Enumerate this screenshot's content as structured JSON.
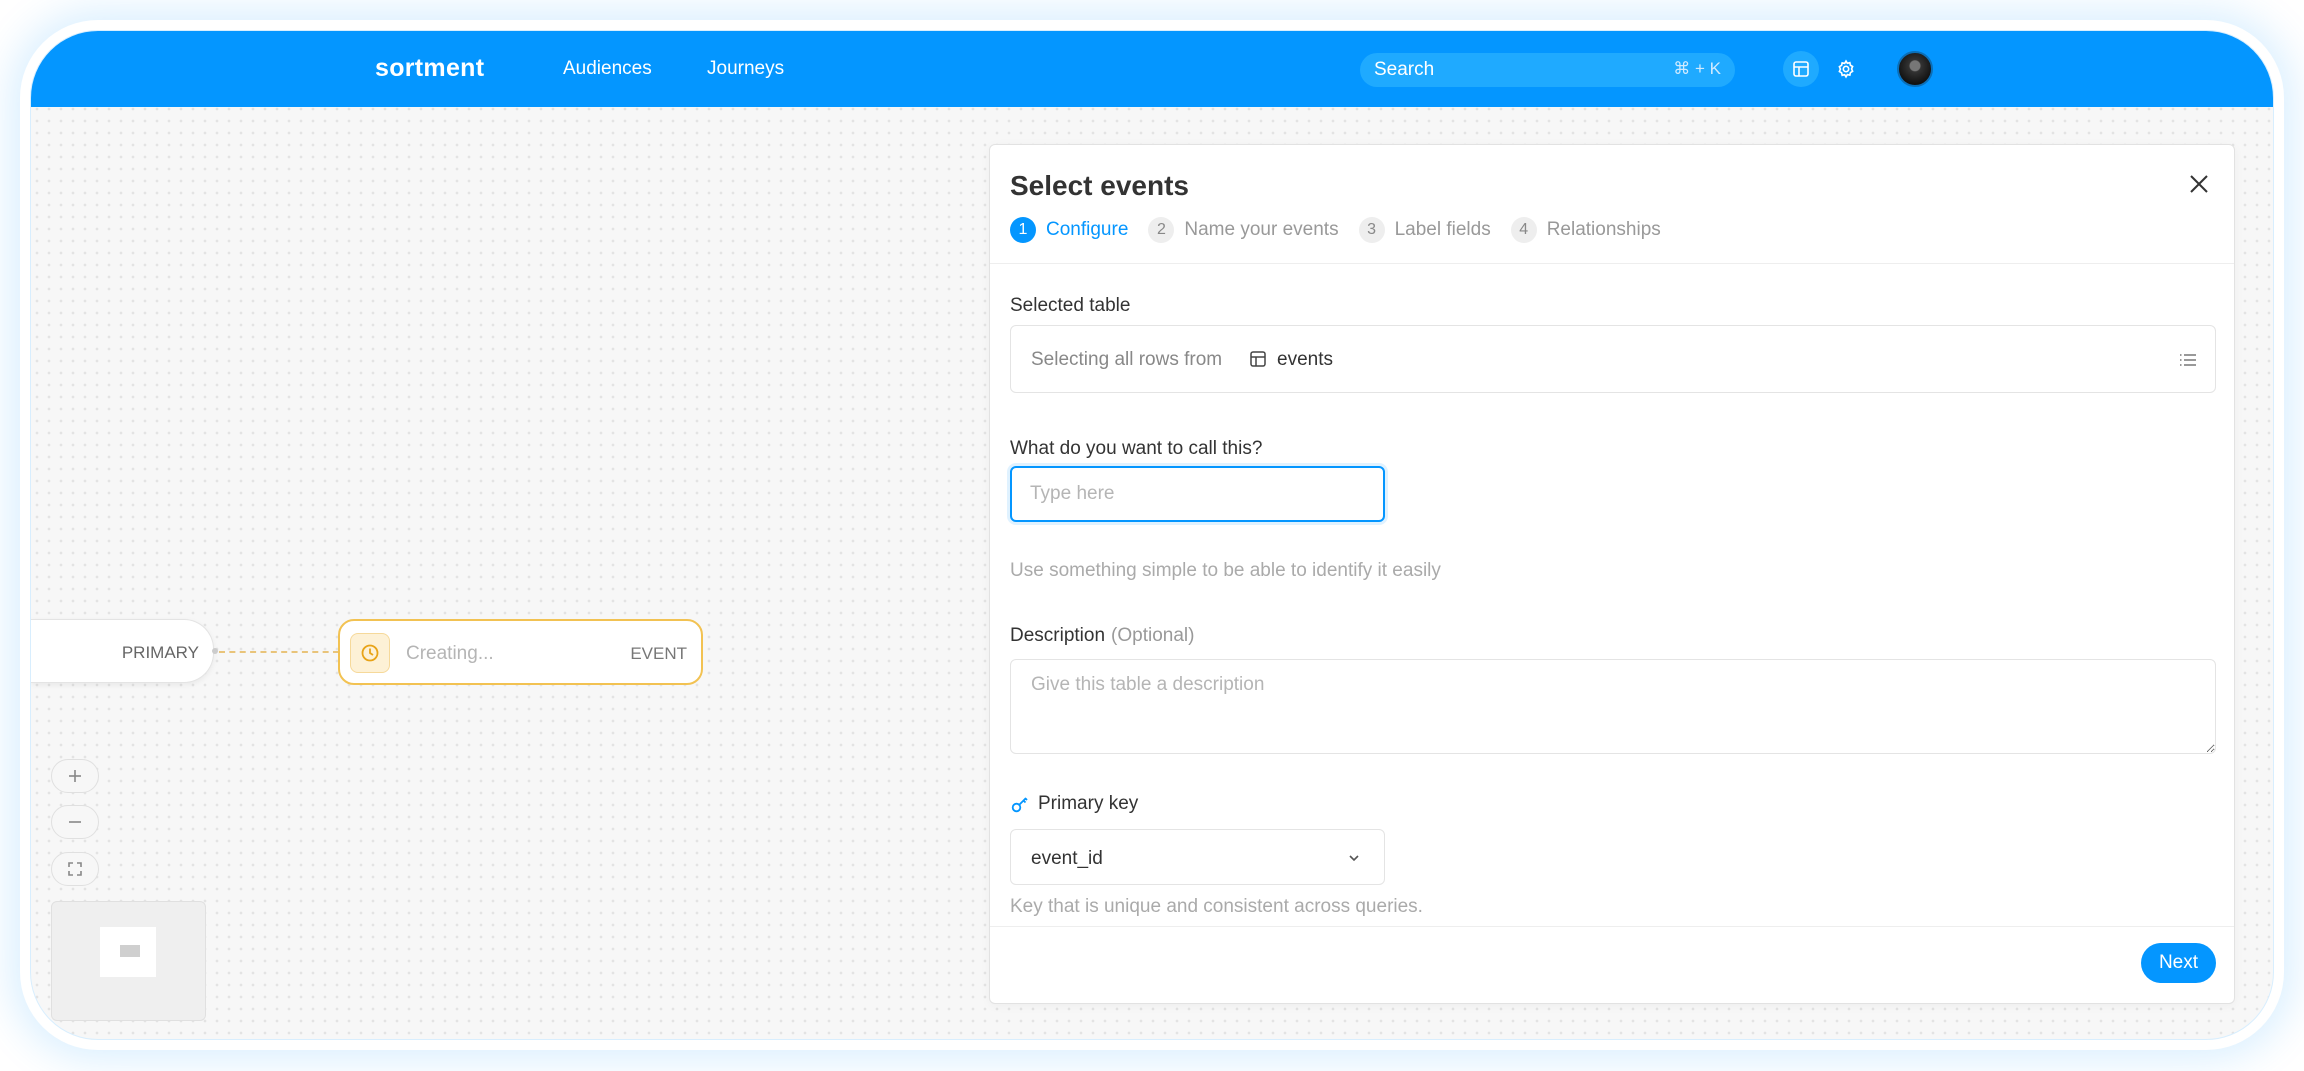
{
  "app": {
    "logo": "sortment",
    "nav": [
      "Audiences",
      "Journeys"
    ],
    "search_placeholder": "Search",
    "search_shortcut": "⌘ + K",
    "accent_color": "#0496ff"
  },
  "canvas": {
    "primary_node_label": "PRIMARY",
    "event_node_status": "Creating...",
    "event_node_type": "EVENT",
    "zoom_controls": [
      "plus-icon",
      "minus-icon",
      "fit-view-icon"
    ]
  },
  "dialog": {
    "title": "Select events",
    "steps": [
      {
        "num": "1",
        "label": "Configure",
        "active": true
      },
      {
        "num": "2",
        "label": "Name your events",
        "active": false
      },
      {
        "num": "3",
        "label": "Label fields",
        "active": false
      },
      {
        "num": "4",
        "label": "Relationships",
        "active": false
      }
    ],
    "selected_table": {
      "label": "Selected table",
      "prefix": "Selecting all rows from",
      "table_name": "events"
    },
    "name_field": {
      "label": "What do you want to call this?",
      "placeholder": "Type here",
      "value": "",
      "hint": "Use something simple to be able to identify it easily"
    },
    "description_field": {
      "label": "Description",
      "optional": "(Optional)",
      "placeholder": "Give this table a description"
    },
    "primary_key": {
      "label": "Primary key",
      "value": "event_id",
      "hint": "Key that is unique and consistent across queries."
    },
    "next_label": "Next"
  }
}
